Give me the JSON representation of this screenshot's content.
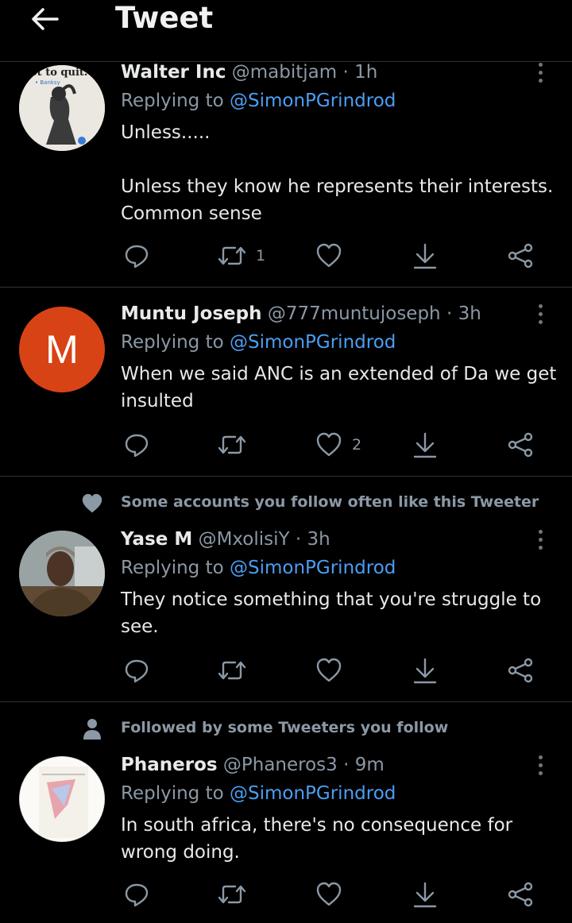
{
  "header": {
    "title": "Tweet"
  },
  "reply_prefix": "Replying to",
  "tweets": [
    {
      "name": "Walter Inc",
      "handle": "@mabitjam · 1h",
      "mention": "@SimonPGrindrod",
      "text": "Unless.....\n\nUnless they know he represents their interests. Common sense",
      "counts": {
        "reply": "",
        "retweet": "1",
        "like": ""
      },
      "avatar_text": {
        "top": "ot to quit.",
        "sub": "• Banksy"
      }
    },
    {
      "name": "Muntu Joseph",
      "handle": "@777muntujoseph · 3h",
      "mention": "@SimonPGrindrod",
      "text": "When we said ANC is an extended of Da we get insulted",
      "counts": {
        "reply": "",
        "retweet": "",
        "like": "2"
      },
      "avatar_text": {
        "letter": "M"
      }
    },
    {
      "social": "Some accounts you follow often like this Tweeter",
      "name": "Yase M",
      "handle": "@MxolisiY · 3h",
      "mention": "@SimonPGrindrod",
      "text": "They notice something that you're struggle to see.",
      "counts": {
        "reply": "",
        "retweet": "",
        "like": ""
      }
    },
    {
      "social": "Followed by some Tweeters you follow",
      "name": "Phaneros",
      "handle": "@Phaneros3 · 9m",
      "mention": "@SimonPGrindrod",
      "text": "In south africa, there's no consequence for wrong doing.",
      "counts": {
        "reply": "",
        "retweet": "",
        "like": ""
      }
    }
  ],
  "colors": {
    "background": "#000000",
    "mention": "#4b9ef2",
    "secondary": "#8b98a5",
    "avatar_m": "#d84315"
  }
}
